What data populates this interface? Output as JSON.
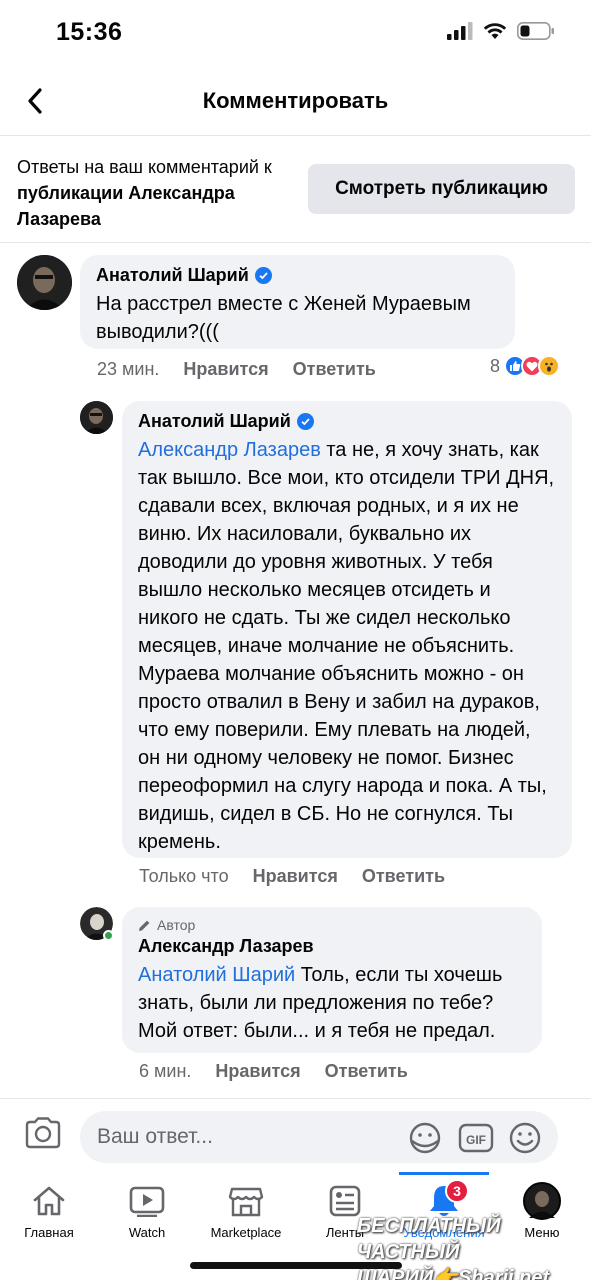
{
  "status_bar": {
    "time": "15:36"
  },
  "header": {
    "title": "Комментировать"
  },
  "context": {
    "text_prefix": "Ответы на ваш комментарий к ",
    "text_bold": "публикации Александра Лазарева",
    "view_post_label": "Смотреть публикацию"
  },
  "comments": [
    {
      "author": "Анатолий Шарий",
      "text": "На расстрел вместе с Женей Мураевым выводили?(((",
      "time": "23 мин.",
      "like_label": "Нравится",
      "reply_label": "Ответить",
      "reaction_count": "8"
    },
    {
      "author": "Анатолий Шарий",
      "mention": "Александр Лазарев",
      "text": " та не, я хочу знать, как так вышло. Все мои, кто отсидели ТРИ ДНЯ, сдавали всех, включая родных, и я их не виню. Их насиловали, буквально их доводили до уровня животных. У тебя вышло несколько месяцев отсидеть и никого не сдать. Ты же сидел несколько месяцев, иначе молчание не объяснить. Мураева молчание объяснить можно - он просто отвалил в Вену и забил на дураков, что ему поверили. Ему плевать на людей, он ни одному человеку не помог. Бизнес переоформил на слугу народа и пока. А ты, видишь, сидел в СБ. Но не согнулся. Ты кремень.",
      "time": "Только что",
      "like_label": "Нравится",
      "reply_label": "Ответить"
    },
    {
      "author_tag": "Автор",
      "author": "Александр Лазарев",
      "mention": "Анатолий Шарий",
      "text": " Толь, если ты хочешь знать, были ли предложения по тебе? Мой ответ: были... и я тебя не предал.",
      "time": "6 мин.",
      "like_label": "Нравится",
      "reply_label": "Ответить"
    }
  ],
  "reply_input": {
    "placeholder": "Ваш ответ..."
  },
  "tabs": [
    {
      "label": "Главная",
      "icon": "home-icon"
    },
    {
      "label": "Watch",
      "icon": "watch-icon"
    },
    {
      "label": "Marketplace",
      "icon": "marketplace-icon"
    },
    {
      "label": "Ленты",
      "icon": "feeds-icon"
    },
    {
      "label": "Уведомления",
      "icon": "bell-icon",
      "badge": "3",
      "active": true
    },
    {
      "label": "Меню",
      "icon": "menu-avatar"
    }
  ],
  "watermark": {
    "line1": "БЕСПЛАТНЫЙ ЧАСТНЫЙ",
    "line2": "ШАРИЙ👉Sharij.net"
  },
  "colors": {
    "link": "#216fdb",
    "accent": "#1877f2",
    "bubble": "#f0f2f5",
    "badge": "#e41e3f"
  }
}
